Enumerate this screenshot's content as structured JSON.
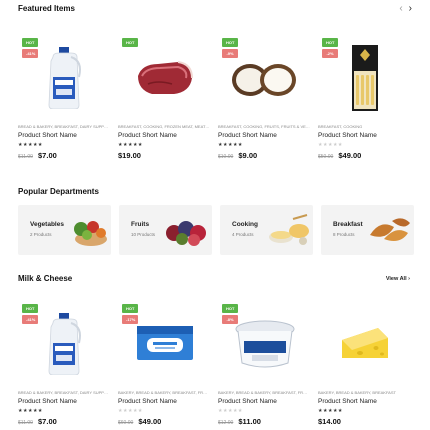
{
  "featured": {
    "title": "Featured Items",
    "prev_icon": "chevron-left-icon",
    "next_icon": "chevron-right-icon",
    "products": [
      {
        "badges": [
          "HOT",
          "-41%"
        ],
        "meta": "BREAD & BAKERY, BREAKFAST, DAIRY SUPPLIES",
        "name": "Product Short Name",
        "rating": 5,
        "old_price": "$11.00",
        "price": "$7.00",
        "image": "milk-jug-image"
      },
      {
        "badges": [
          "HOT"
        ],
        "meta": "BREAKFAST, COOKING, FROZEN MEAT, MEAT & SEAFOOD",
        "name": "Product Short Name",
        "rating": 5,
        "old_price": "",
        "price": "$19.00",
        "image": "raw-meat-image"
      },
      {
        "badges": [
          "HOT",
          "-9%"
        ],
        "meta": "BREAKFAST, COOKING, FRUITS, FRUITS & VEGETABLES",
        "name": "Product Short Name",
        "rating": 5,
        "old_price": "$10.00",
        "price": "$9.00",
        "image": "coconut-image"
      },
      {
        "badges": [
          "HOT",
          "-2%"
        ],
        "meta": "BREAKFAST, COOKING",
        "name": "Product Short Name",
        "rating": 0,
        "old_price": "$50.00",
        "price": "$49.00",
        "image": "pasta-box-image"
      }
    ]
  },
  "departments": {
    "title": "Popular Departments",
    "items": [
      {
        "name": "Vegetables",
        "count": "2 Products",
        "image": "vegetables-image"
      },
      {
        "name": "Fruits",
        "count": "10 Products",
        "image": "fruits-image"
      },
      {
        "name": "Cooking",
        "count": "4 Products",
        "image": "cooking-image"
      },
      {
        "name": "Breakfast",
        "count": "8 Products",
        "image": "breakfast-image"
      }
    ]
  },
  "milk": {
    "title": "Milk & Cheese",
    "view_all": "View All",
    "products": [
      {
        "badges": [
          "HOT",
          "-41%"
        ],
        "meta": "BREAD & BAKERY, BREAKFAST, DAIRY SUPPLIES",
        "name": "Product Short Name",
        "rating": 5,
        "old_price": "$11.00",
        "price": "$7.00",
        "image": "milk-jug-image"
      },
      {
        "badges": [
          "HOT",
          "-17%"
        ],
        "meta": "BAKERY, BREAD & BAKERY, BREAKFAST, FROZEN",
        "name": "Product Short Name",
        "rating": 0,
        "old_price": "$60.00",
        "price": "$49.00",
        "image": "cream-cheese-box-image"
      },
      {
        "badges": [
          "HOT",
          "-8%"
        ],
        "meta": "BAKERY, BREAD & BAKERY, BREAKFAST, FROZEN",
        "name": "Product Short Name",
        "rating": 0,
        "old_price": "$12.00",
        "price": "$11.00",
        "image": "cream-tub-image"
      },
      {
        "badges": [],
        "meta": "BAKERY, BREAD & BAKERY, BREAKFAST",
        "name": "Product Short Name",
        "rating": 5,
        "old_price": "",
        "price": "$14.00",
        "image": "cheese-wedge-image"
      }
    ]
  }
}
